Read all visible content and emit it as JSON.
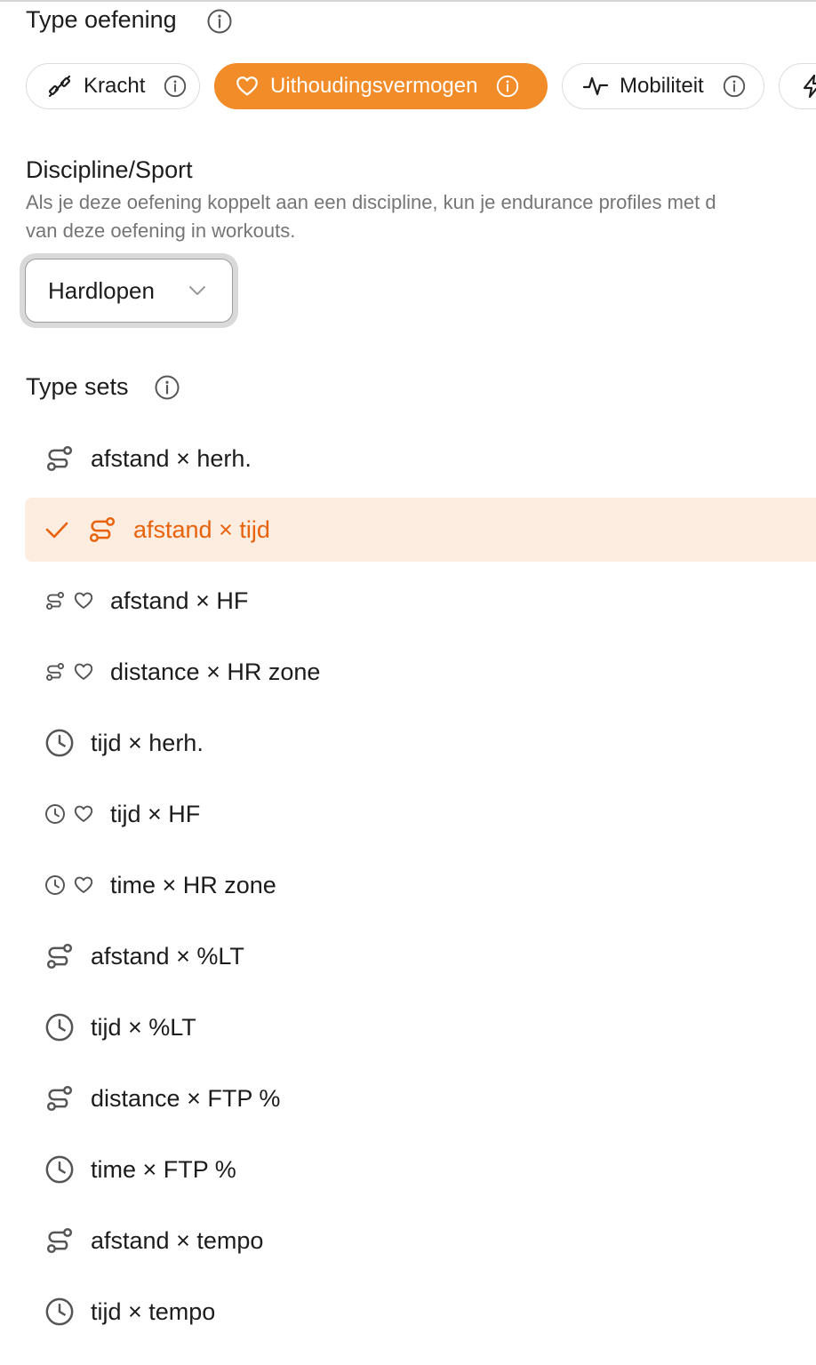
{
  "section_type": {
    "title": "Type oefening"
  },
  "chips": [
    {
      "label": "Kracht",
      "icon": "dumbbell-icon"
    },
    {
      "label": "Uithoudingsvermogen",
      "icon": "heart-icon",
      "active": true
    },
    {
      "label": "Mobiliteit",
      "icon": "activity-icon"
    },
    {
      "label": "",
      "icon": "lightning-icon"
    }
  ],
  "discipline": {
    "title": "Discipline/Sport",
    "desc_line1": "Als je deze oefening koppelt aan een discipline, kun je endurance profiles met d",
    "desc_line2": "van deze oefening in workouts.",
    "selected": "Hardlopen"
  },
  "sets": {
    "title": "Type sets",
    "items": [
      {
        "label": "afstand × herh.",
        "icons": [
          "route"
        ]
      },
      {
        "label": "afstand × tijd",
        "icons": [
          "route"
        ],
        "selected": true
      },
      {
        "label": "afstand × HF",
        "icons": [
          "route-small",
          "heart-small"
        ]
      },
      {
        "label": "distance × HR zone",
        "icons": [
          "route-small",
          "heart-small"
        ]
      },
      {
        "label": "tijd × herh.",
        "icons": [
          "clock"
        ]
      },
      {
        "label": "tijd × HF",
        "icons": [
          "clock-small",
          "heart-small"
        ]
      },
      {
        "label": "time × HR zone",
        "icons": [
          "clock-small",
          "heart-small"
        ]
      },
      {
        "label": "afstand × %LT",
        "icons": [
          "route"
        ]
      },
      {
        "label": "tijd × %LT",
        "icons": [
          "clock"
        ]
      },
      {
        "label": "distance × FTP %",
        "icons": [
          "route"
        ]
      },
      {
        "label": "time × FTP %",
        "icons": [
          "clock"
        ]
      },
      {
        "label": "afstand × tempo",
        "icons": [
          "route"
        ]
      },
      {
        "label": "tijd × tempo",
        "icons": [
          "clock"
        ]
      }
    ]
  },
  "colors": {
    "accent": "#f28c28",
    "accent_text": "#e8620c",
    "selected_bg": "#fdece0"
  }
}
